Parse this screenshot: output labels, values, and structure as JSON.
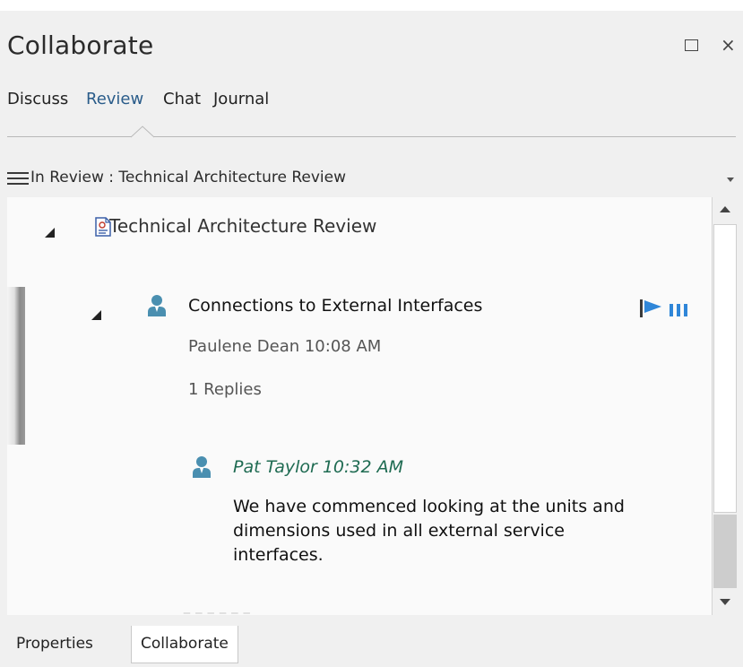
{
  "window": {
    "title": "Collaborate",
    "maximize_icon": "maximize-icon",
    "close_icon": "close-icon",
    "close_glyph": "×"
  },
  "tabs": [
    {
      "label": "Discuss",
      "active": false
    },
    {
      "label": "Review",
      "active": true
    },
    {
      "label": "Chat",
      "active": false
    },
    {
      "label": "Journal",
      "active": false
    }
  ],
  "header": {
    "text": "In Review : Technical Architecture Review",
    "menu_icon": "hamburger-icon"
  },
  "tree": {
    "root": {
      "label": "Technical Architecture Review",
      "icon": "review-document-icon"
    },
    "thread": {
      "title": "Connections to External Interfaces",
      "meta": "Paulene Dean  10:08 AM",
      "replies": "1 Replies",
      "icons": [
        "flag-icon",
        "bars-icon"
      ]
    },
    "reply": {
      "author": "Pat Taylor  10:32 AM",
      "body": "We have commenced looking at the units and dimensions used in all external service interfaces."
    }
  },
  "bottom_tabs": [
    {
      "label": "Properties",
      "active": false
    },
    {
      "label": "Collaborate",
      "active": true
    }
  ],
  "colors": {
    "accent_tab": "#2a5c8a",
    "reply_author": "#1f6b52",
    "person_icon": "#4a8fb0",
    "flag": "#2f86d8"
  }
}
